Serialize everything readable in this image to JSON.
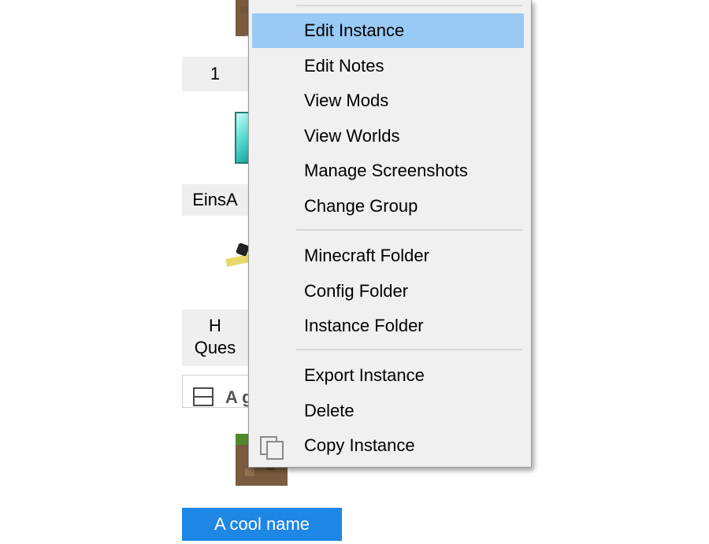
{
  "background": {
    "instance_labels": [
      {
        "text": "1"
      },
      {
        "text": "EinsA"
      },
      {
        "line1": "H",
        "line2": "Ques"
      }
    ],
    "group_header": {
      "label": "A g"
    },
    "selected_instance": {
      "name": "A cool name"
    },
    "icons": [
      "dirt-block-icon",
      "diamond-block-icon",
      "quest-book-icon",
      "grass-block-icon"
    ]
  },
  "context_menu": {
    "items": [
      {
        "label": "Edit Instance",
        "hovered": true
      },
      {
        "label": "Edit Notes"
      },
      {
        "label": "View Mods"
      },
      {
        "label": "View Worlds"
      },
      {
        "label": "Manage Screenshots"
      },
      {
        "label": "Change Group"
      },
      {
        "label": "Minecraft Folder"
      },
      {
        "label": "Config Folder"
      },
      {
        "label": "Instance Folder"
      },
      {
        "label": "Export Instance"
      },
      {
        "label": "Delete"
      },
      {
        "label": "Copy Instance",
        "icon": "copy-icon"
      }
    ],
    "colors": {
      "hover": "#99c9f5",
      "menu_bg": "#f0f0f0",
      "selection": "#1e86e5"
    }
  }
}
